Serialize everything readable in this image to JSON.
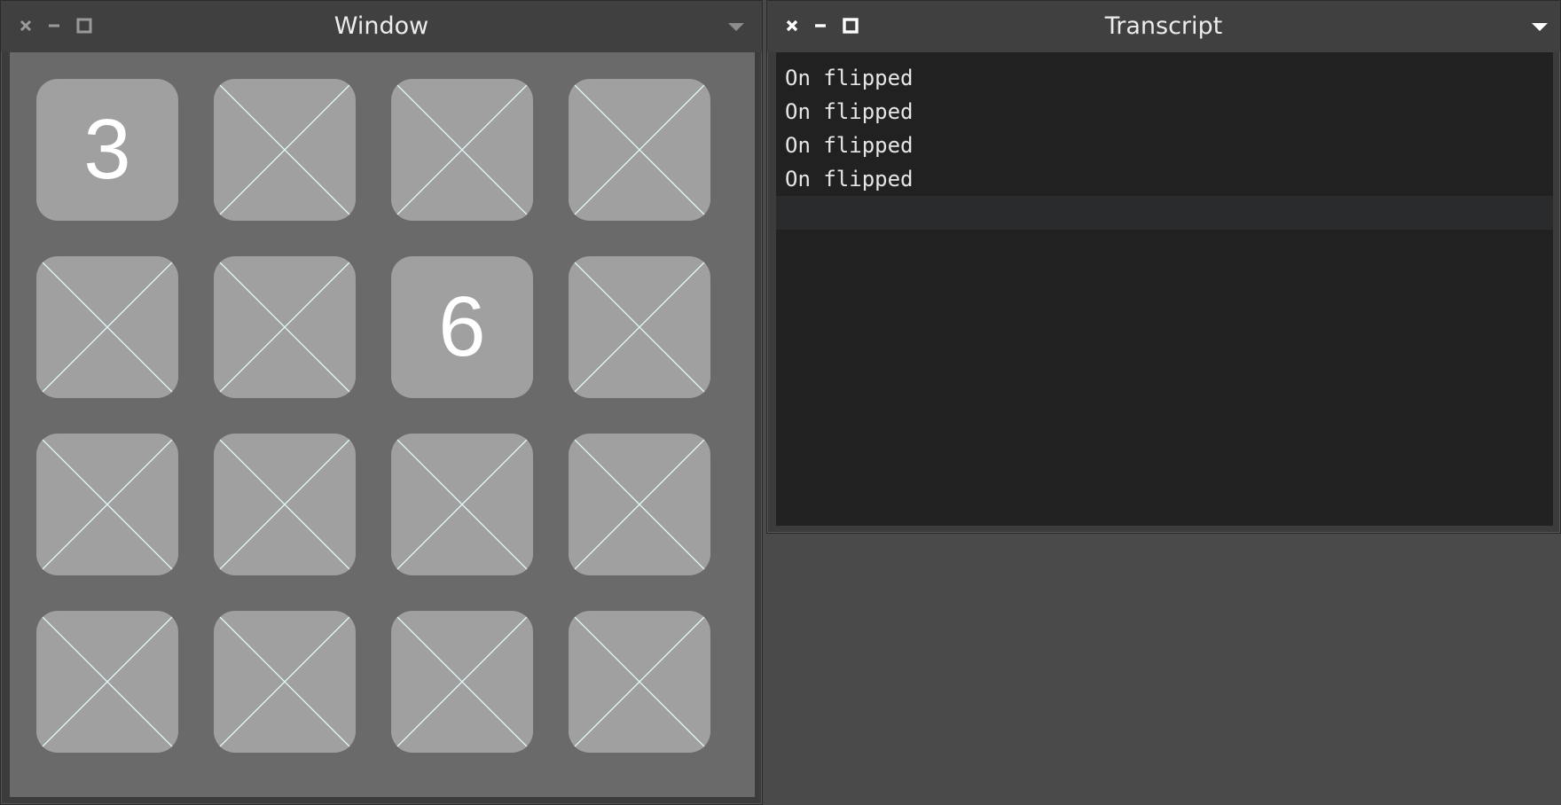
{
  "game_window": {
    "title": "Window",
    "buttons": {
      "close_icon": "close-icon",
      "minimize_icon": "minimize-icon",
      "maximize_icon": "maximize-icon",
      "menu_icon": "chevron-down-icon"
    },
    "cards": [
      {
        "face": "3",
        "revealed": true
      },
      {
        "face": "",
        "revealed": false
      },
      {
        "face": "",
        "revealed": false
      },
      {
        "face": "",
        "revealed": false
      },
      {
        "face": "",
        "revealed": false
      },
      {
        "face": "",
        "revealed": false
      },
      {
        "face": "6",
        "revealed": true
      },
      {
        "face": "",
        "revealed": false
      },
      {
        "face": "",
        "revealed": false
      },
      {
        "face": "",
        "revealed": false
      },
      {
        "face": "",
        "revealed": false
      },
      {
        "face": "",
        "revealed": false
      },
      {
        "face": "",
        "revealed": false
      },
      {
        "face": "",
        "revealed": false
      },
      {
        "face": "",
        "revealed": false
      },
      {
        "face": "",
        "revealed": false
      }
    ]
  },
  "transcript_window": {
    "title": "Transcript",
    "lines": [
      "On flipped",
      "On flipped",
      "On flipped",
      "On flipped",
      ""
    ]
  },
  "colors": {
    "desktop": "#4a4a4a",
    "board": "#6a6a6a",
    "card": "#a0a0a0",
    "card_cross": "#e8ffff",
    "transcript_bg": "#212121"
  }
}
